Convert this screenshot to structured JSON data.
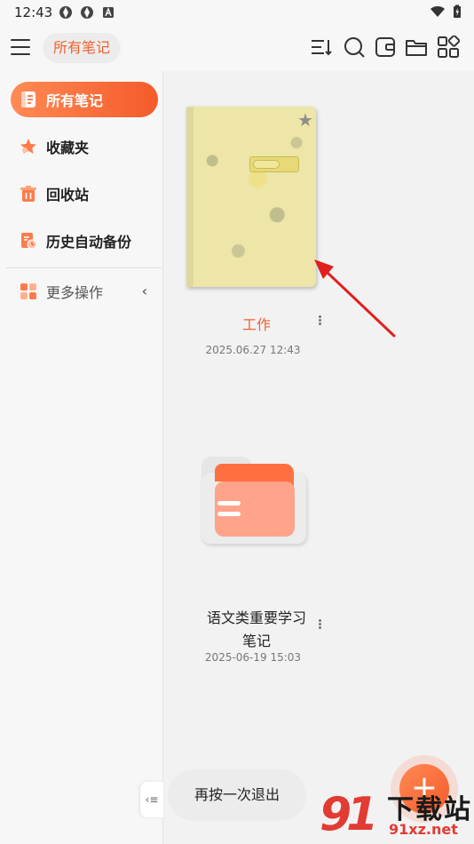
{
  "statusbar": {
    "time": "12:43"
  },
  "header": {
    "title": "所有笔记"
  },
  "sidebar": {
    "items": [
      {
        "label": "所有笔记",
        "icon": "notes-icon",
        "active": true
      },
      {
        "label": "收藏夹",
        "icon": "star-icon",
        "active": false
      },
      {
        "label": "回收站",
        "icon": "trash-icon",
        "active": false
      },
      {
        "label": "历史自动备份",
        "icon": "backup-icon",
        "active": false
      }
    ],
    "more": {
      "label": "更多操作",
      "icon": "grid-icon"
    }
  },
  "notes": [
    {
      "title": "工作",
      "date": "2025.06.27 12:43",
      "type": "notebook",
      "starred": true
    },
    {
      "title_line1": "语文类重要学习",
      "title_line2": "笔记",
      "date": "2025-06-19 15:03",
      "type": "folder"
    }
  ],
  "toast": {
    "text": "再按一次退出"
  },
  "watermark": {
    "logo": "91",
    "text": "下载站",
    "url": "91xz.net"
  },
  "colors": {
    "accent": "#f55a2a",
    "accent_light": "#ff8a55",
    "folder_back": "#ff7040",
    "folder_front": "#ffa48a"
  }
}
